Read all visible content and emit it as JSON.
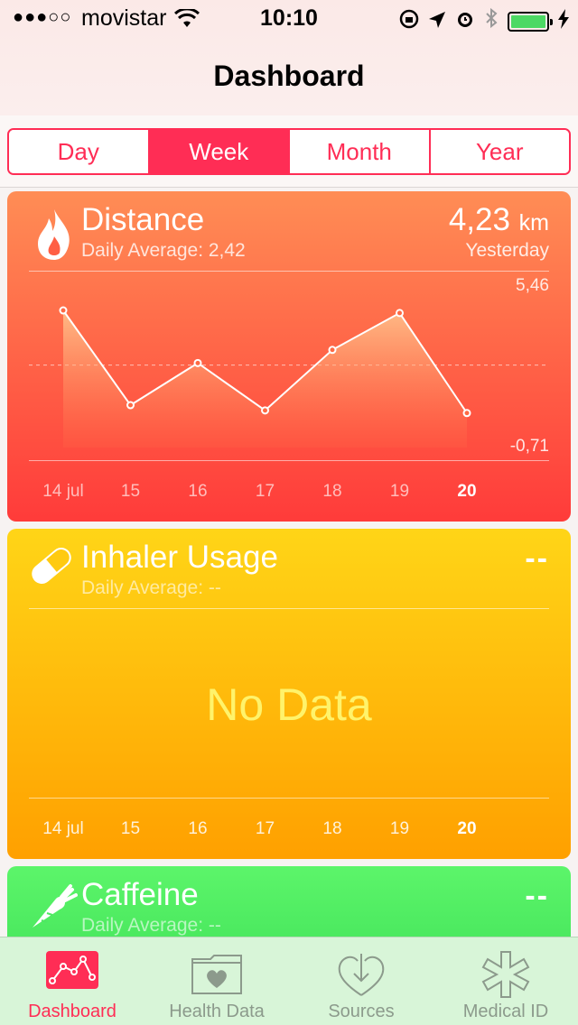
{
  "status_bar": {
    "signal": "●●●○○",
    "carrier": "movistar",
    "time": "10:10"
  },
  "nav": {
    "title": "Dashboard"
  },
  "segments": [
    {
      "label": "Day",
      "active": false
    },
    {
      "label": "Week",
      "active": true
    },
    {
      "label": "Month",
      "active": false
    },
    {
      "label": "Year",
      "active": false
    }
  ],
  "cards": {
    "distance": {
      "title": "Distance",
      "subtitle": "Daily Average: 2,42",
      "value": "4,23",
      "unit": "km",
      "when": "Yesterday",
      "y_max_label": "5,46",
      "y_min_label": "-0,71",
      "icon": "flame-icon",
      "color_top": "#ff8d55",
      "color_bottom": "#ff3b3a"
    },
    "inhaler": {
      "title": "Inhaler Usage",
      "subtitle": "Daily Average: --",
      "value": "--",
      "no_data": "No Data",
      "icon": "pill-icon",
      "color_top": "#ffd517",
      "color_bottom": "#ffa000"
    },
    "caffeine": {
      "title": "Caffeine",
      "subtitle": "Daily Average: --",
      "value": "--",
      "icon": "carrot-icon",
      "color_top": "#5cf56a",
      "color_bottom": "#43e35a"
    }
  },
  "x_labels": [
    "14 jul",
    "15",
    "16",
    "17",
    "18",
    "19",
    "20"
  ],
  "chart_data": {
    "type": "area",
    "categories": [
      "14 jul",
      "15",
      "16",
      "17",
      "18",
      "19",
      "20"
    ],
    "values": [
      4.5,
      0.9,
      2.5,
      0.7,
      3.0,
      4.4,
      0.6
    ],
    "ylim": [
      -0.71,
      5.46
    ],
    "average": 2.42
  },
  "tabbar": {
    "items": [
      {
        "label": "Dashboard",
        "icon": "dashboard-chart-icon",
        "active": true
      },
      {
        "label": "Health Data",
        "icon": "health-folder-icon",
        "active": false
      },
      {
        "label": "Sources",
        "icon": "sources-download-icon",
        "active": false
      },
      {
        "label": "Medical ID",
        "icon": "medical-star-icon",
        "active": false
      }
    ]
  }
}
